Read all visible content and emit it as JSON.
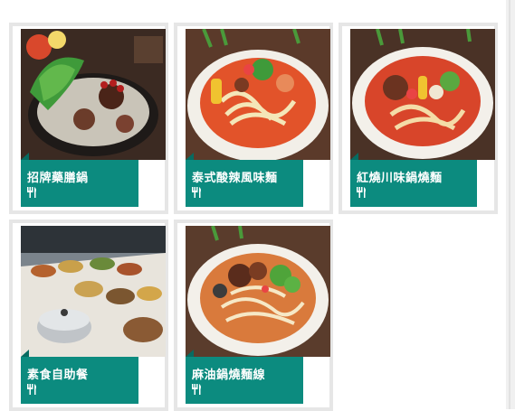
{
  "menu_items": [
    {
      "name": "招牌藥膳鍋",
      "icon": "utensils-icon"
    },
    {
      "name": "泰式酸辣風味麵",
      "icon": "utensils-icon"
    },
    {
      "name": "紅燒川味鍋燒麵",
      "icon": "utensils-icon"
    },
    {
      "name": "素食自助餐",
      "icon": "utensils-icon"
    },
    {
      "name": "麻油鍋燒麵線",
      "icon": "utensils-icon"
    }
  ],
  "colors": {
    "tab": "#0c8b7f",
    "card_border": "#e6e6e6"
  }
}
